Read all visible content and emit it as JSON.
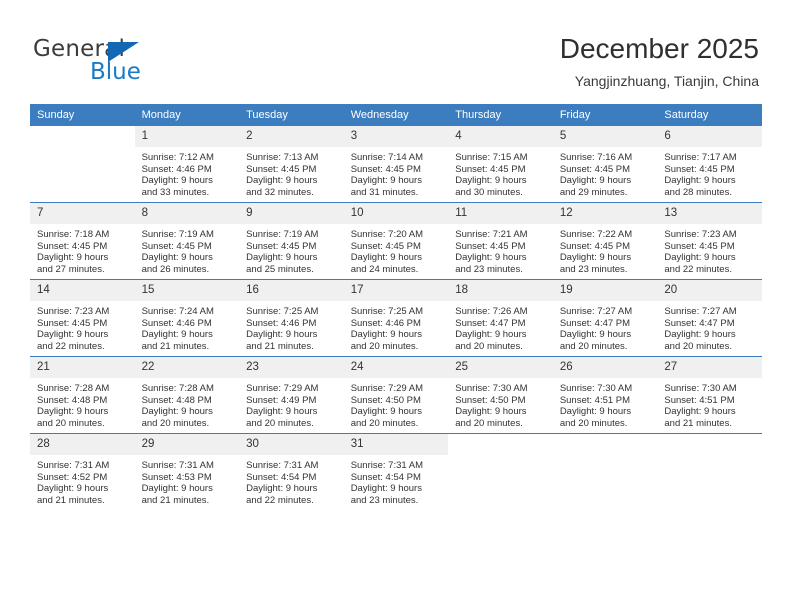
{
  "logo": {
    "word1": "General",
    "word2": "Blue",
    "triangle_color": "#1268b3",
    "blue_color": "#1a7bc4"
  },
  "header": {
    "title": "December 2025",
    "location": "Yangjinzhuang, Tianjin, China"
  },
  "theme": {
    "header_bg": "#3b7dbf",
    "daynum_bg": "#f0f0f0",
    "grid_line": "#3b7dbf"
  },
  "weekdays": [
    "Sunday",
    "Monday",
    "Tuesday",
    "Wednesday",
    "Thursday",
    "Friday",
    "Saturday"
  ],
  "weeks": [
    [
      {
        "day": "",
        "sunrise": "",
        "sunset": "",
        "daylight1": "",
        "daylight2": ""
      },
      {
        "day": "1",
        "sunrise": "Sunrise: 7:12 AM",
        "sunset": "Sunset: 4:46 PM",
        "daylight1": "Daylight: 9 hours",
        "daylight2": "and 33 minutes."
      },
      {
        "day": "2",
        "sunrise": "Sunrise: 7:13 AM",
        "sunset": "Sunset: 4:45 PM",
        "daylight1": "Daylight: 9 hours",
        "daylight2": "and 32 minutes."
      },
      {
        "day": "3",
        "sunrise": "Sunrise: 7:14 AM",
        "sunset": "Sunset: 4:45 PM",
        "daylight1": "Daylight: 9 hours",
        "daylight2": "and 31 minutes."
      },
      {
        "day": "4",
        "sunrise": "Sunrise: 7:15 AM",
        "sunset": "Sunset: 4:45 PM",
        "daylight1": "Daylight: 9 hours",
        "daylight2": "and 30 minutes."
      },
      {
        "day": "5",
        "sunrise": "Sunrise: 7:16 AM",
        "sunset": "Sunset: 4:45 PM",
        "daylight1": "Daylight: 9 hours",
        "daylight2": "and 29 minutes."
      },
      {
        "day": "6",
        "sunrise": "Sunrise: 7:17 AM",
        "sunset": "Sunset: 4:45 PM",
        "daylight1": "Daylight: 9 hours",
        "daylight2": "and 28 minutes."
      }
    ],
    [
      {
        "day": "7",
        "sunrise": "Sunrise: 7:18 AM",
        "sunset": "Sunset: 4:45 PM",
        "daylight1": "Daylight: 9 hours",
        "daylight2": "and 27 minutes."
      },
      {
        "day": "8",
        "sunrise": "Sunrise: 7:19 AM",
        "sunset": "Sunset: 4:45 PM",
        "daylight1": "Daylight: 9 hours",
        "daylight2": "and 26 minutes."
      },
      {
        "day": "9",
        "sunrise": "Sunrise: 7:19 AM",
        "sunset": "Sunset: 4:45 PM",
        "daylight1": "Daylight: 9 hours",
        "daylight2": "and 25 minutes."
      },
      {
        "day": "10",
        "sunrise": "Sunrise: 7:20 AM",
        "sunset": "Sunset: 4:45 PM",
        "daylight1": "Daylight: 9 hours",
        "daylight2": "and 24 minutes."
      },
      {
        "day": "11",
        "sunrise": "Sunrise: 7:21 AM",
        "sunset": "Sunset: 4:45 PM",
        "daylight1": "Daylight: 9 hours",
        "daylight2": "and 23 minutes."
      },
      {
        "day": "12",
        "sunrise": "Sunrise: 7:22 AM",
        "sunset": "Sunset: 4:45 PM",
        "daylight1": "Daylight: 9 hours",
        "daylight2": "and 23 minutes."
      },
      {
        "day": "13",
        "sunrise": "Sunrise: 7:23 AM",
        "sunset": "Sunset: 4:45 PM",
        "daylight1": "Daylight: 9 hours",
        "daylight2": "and 22 minutes."
      }
    ],
    [
      {
        "day": "14",
        "sunrise": "Sunrise: 7:23 AM",
        "sunset": "Sunset: 4:45 PM",
        "daylight1": "Daylight: 9 hours",
        "daylight2": "and 22 minutes."
      },
      {
        "day": "15",
        "sunrise": "Sunrise: 7:24 AM",
        "sunset": "Sunset: 4:46 PM",
        "daylight1": "Daylight: 9 hours",
        "daylight2": "and 21 minutes."
      },
      {
        "day": "16",
        "sunrise": "Sunrise: 7:25 AM",
        "sunset": "Sunset: 4:46 PM",
        "daylight1": "Daylight: 9 hours",
        "daylight2": "and 21 minutes."
      },
      {
        "day": "17",
        "sunrise": "Sunrise: 7:25 AM",
        "sunset": "Sunset: 4:46 PM",
        "daylight1": "Daylight: 9 hours",
        "daylight2": "and 20 minutes."
      },
      {
        "day": "18",
        "sunrise": "Sunrise: 7:26 AM",
        "sunset": "Sunset: 4:47 PM",
        "daylight1": "Daylight: 9 hours",
        "daylight2": "and 20 minutes."
      },
      {
        "day": "19",
        "sunrise": "Sunrise: 7:27 AM",
        "sunset": "Sunset: 4:47 PM",
        "daylight1": "Daylight: 9 hours",
        "daylight2": "and 20 minutes."
      },
      {
        "day": "20",
        "sunrise": "Sunrise: 7:27 AM",
        "sunset": "Sunset: 4:47 PM",
        "daylight1": "Daylight: 9 hours",
        "daylight2": "and 20 minutes."
      }
    ],
    [
      {
        "day": "21",
        "sunrise": "Sunrise: 7:28 AM",
        "sunset": "Sunset: 4:48 PM",
        "daylight1": "Daylight: 9 hours",
        "daylight2": "and 20 minutes."
      },
      {
        "day": "22",
        "sunrise": "Sunrise: 7:28 AM",
        "sunset": "Sunset: 4:48 PM",
        "daylight1": "Daylight: 9 hours",
        "daylight2": "and 20 minutes."
      },
      {
        "day": "23",
        "sunrise": "Sunrise: 7:29 AM",
        "sunset": "Sunset: 4:49 PM",
        "daylight1": "Daylight: 9 hours",
        "daylight2": "and 20 minutes."
      },
      {
        "day": "24",
        "sunrise": "Sunrise: 7:29 AM",
        "sunset": "Sunset: 4:50 PM",
        "daylight1": "Daylight: 9 hours",
        "daylight2": "and 20 minutes."
      },
      {
        "day": "25",
        "sunrise": "Sunrise: 7:30 AM",
        "sunset": "Sunset: 4:50 PM",
        "daylight1": "Daylight: 9 hours",
        "daylight2": "and 20 minutes."
      },
      {
        "day": "26",
        "sunrise": "Sunrise: 7:30 AM",
        "sunset": "Sunset: 4:51 PM",
        "daylight1": "Daylight: 9 hours",
        "daylight2": "and 20 minutes."
      },
      {
        "day": "27",
        "sunrise": "Sunrise: 7:30 AM",
        "sunset": "Sunset: 4:51 PM",
        "daylight1": "Daylight: 9 hours",
        "daylight2": "and 21 minutes."
      }
    ],
    [
      {
        "day": "28",
        "sunrise": "Sunrise: 7:31 AM",
        "sunset": "Sunset: 4:52 PM",
        "daylight1": "Daylight: 9 hours",
        "daylight2": "and 21 minutes."
      },
      {
        "day": "29",
        "sunrise": "Sunrise: 7:31 AM",
        "sunset": "Sunset: 4:53 PM",
        "daylight1": "Daylight: 9 hours",
        "daylight2": "and 21 minutes."
      },
      {
        "day": "30",
        "sunrise": "Sunrise: 7:31 AM",
        "sunset": "Sunset: 4:54 PM",
        "daylight1": "Daylight: 9 hours",
        "daylight2": "and 22 minutes."
      },
      {
        "day": "31",
        "sunrise": "Sunrise: 7:31 AM",
        "sunset": "Sunset: 4:54 PM",
        "daylight1": "Daylight: 9 hours",
        "daylight2": "and 23 minutes."
      },
      {
        "day": "",
        "sunrise": "",
        "sunset": "",
        "daylight1": "",
        "daylight2": ""
      },
      {
        "day": "",
        "sunrise": "",
        "sunset": "",
        "daylight1": "",
        "daylight2": ""
      },
      {
        "day": "",
        "sunrise": "",
        "sunset": "",
        "daylight1": "",
        "daylight2": ""
      }
    ]
  ]
}
